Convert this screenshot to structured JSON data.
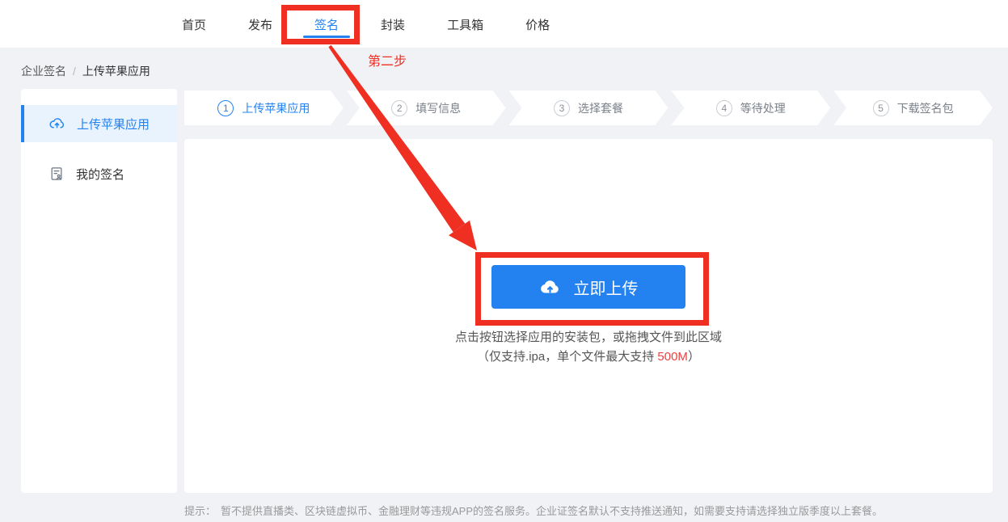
{
  "nav": {
    "tabs": [
      "首页",
      "发布",
      "签名",
      "封装",
      "工具箱",
      "价格"
    ],
    "active_tab": "签名"
  },
  "breadcrumb": {
    "parent": "企业签名",
    "separator": "/",
    "current": "上传苹果应用"
  },
  "sidebar": {
    "items": [
      {
        "label": "上传苹果应用",
        "icon": "cloud-upload-icon",
        "selected": true
      },
      {
        "label": "我的签名",
        "icon": "signature-doc-icon",
        "selected": false
      }
    ]
  },
  "steps": [
    {
      "num": "1",
      "label": "上传苹果应用",
      "active": true
    },
    {
      "num": "2",
      "label": "填写信息",
      "active": false
    },
    {
      "num": "3",
      "label": "选择套餐",
      "active": false
    },
    {
      "num": "4",
      "label": "等待处理",
      "active": false
    },
    {
      "num": "5",
      "label": "下载签名包",
      "active": false
    }
  ],
  "upload": {
    "button_label": "立即上传",
    "hint_line1": "点击按钮选择应用的安装包，或拖拽文件到此区域",
    "hint_line2_prefix": "（仅支持.ipa，单个文件最大支持 ",
    "hint_line2_highlight": "500M",
    "hint_line2_suffix": "）"
  },
  "footer": {
    "tip_label": "提示：",
    "tip_text": "暂不提供直播类、区块链虚拟币、金融理财等违规APP的签名服务。企业证签名默认不支持推送通知，如需要支持请选择独立版季度以上套餐。"
  },
  "annotations": {
    "step_note": "第二步"
  },
  "colors": {
    "accent": "#2482f0",
    "accent_light": "#e8f3fe",
    "annotation_red": "#ee2f22",
    "highlight_red": "#f03e3e",
    "page_bg": "#f0f2f5"
  }
}
